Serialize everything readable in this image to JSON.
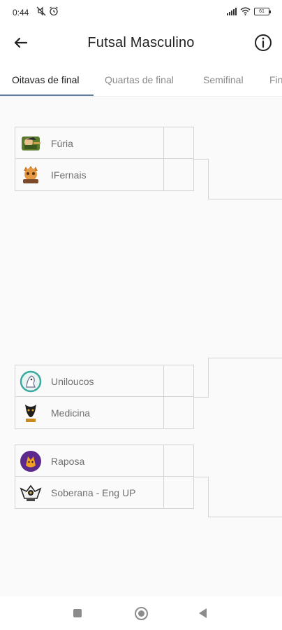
{
  "status_bar": {
    "time": "0:44",
    "battery": "61",
    "icons": [
      "mute-icon",
      "alarm-icon",
      "signal-icon",
      "wifi-icon",
      "battery-icon"
    ]
  },
  "app_bar": {
    "title": "Futsal Masculino",
    "back_icon": "arrow-left-icon",
    "info_icon": "info-icon"
  },
  "tabs": [
    {
      "label": "Oitavas de final",
      "active": true
    },
    {
      "label": "Quartas de final",
      "active": false
    },
    {
      "label": "Semifinal",
      "active": false
    },
    {
      "label": "Fin",
      "active": false
    }
  ],
  "bracket": {
    "matches": [
      {
        "team1": "Fúria",
        "team2": "IFernais",
        "score1": "",
        "score2": ""
      },
      {
        "team1": "Uniloucos",
        "team2": "Medicina",
        "score1": "",
        "score2": ""
      },
      {
        "team1": "Raposa",
        "team2": "Soberana - Eng UP",
        "score1": "",
        "score2": ""
      }
    ]
  },
  "colors": {
    "accent": "#5a7fa3",
    "line": "#d4d4d4",
    "background": "#fafafa"
  },
  "nav_bar": {
    "icons": [
      "recents-square-icon",
      "home-circle-icon",
      "back-triangle-icon"
    ]
  }
}
